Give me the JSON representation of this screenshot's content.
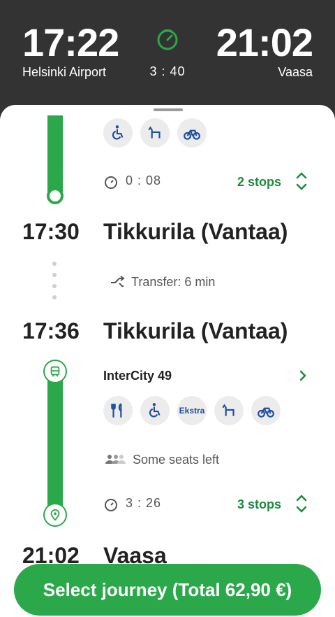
{
  "header": {
    "departure_time": "17:22",
    "departure_place": "Helsinki Airport",
    "arrival_time": "21:02",
    "arrival_place": "Vaasa",
    "duration": "3 : 40"
  },
  "segment1": {
    "amenities": [
      "wheelchair-icon",
      "pet-icon",
      "bicycle-icon"
    ],
    "duration": "0 : 08",
    "stops": "2 stops"
  },
  "stop1": {
    "time": "17:30",
    "station": "Tikkurila (Vantaa)"
  },
  "transfer": {
    "label": "Transfer: 6 min"
  },
  "stop2": {
    "time": "17:36",
    "station": "Tikkurila (Vantaa)"
  },
  "segment2": {
    "train": "InterCity 49",
    "amenities": [
      "restaurant-icon",
      "wheelchair-icon",
      "ekstra",
      "pet-icon",
      "bicycle-icon"
    ],
    "ekstra_label": "Ekstra",
    "seats": "Some seats left",
    "duration": "3 : 26",
    "stops": "3 stops"
  },
  "stop3": {
    "time": "21:02",
    "station": "Vaasa"
  },
  "cta": {
    "label": "Select journey (Total 62,90 €)"
  },
  "colors": {
    "header_bg": "#333333",
    "accent_green": "#2aa84a",
    "text_green": "#1e8a3d",
    "amenity_blue": "#1f4f9e"
  }
}
